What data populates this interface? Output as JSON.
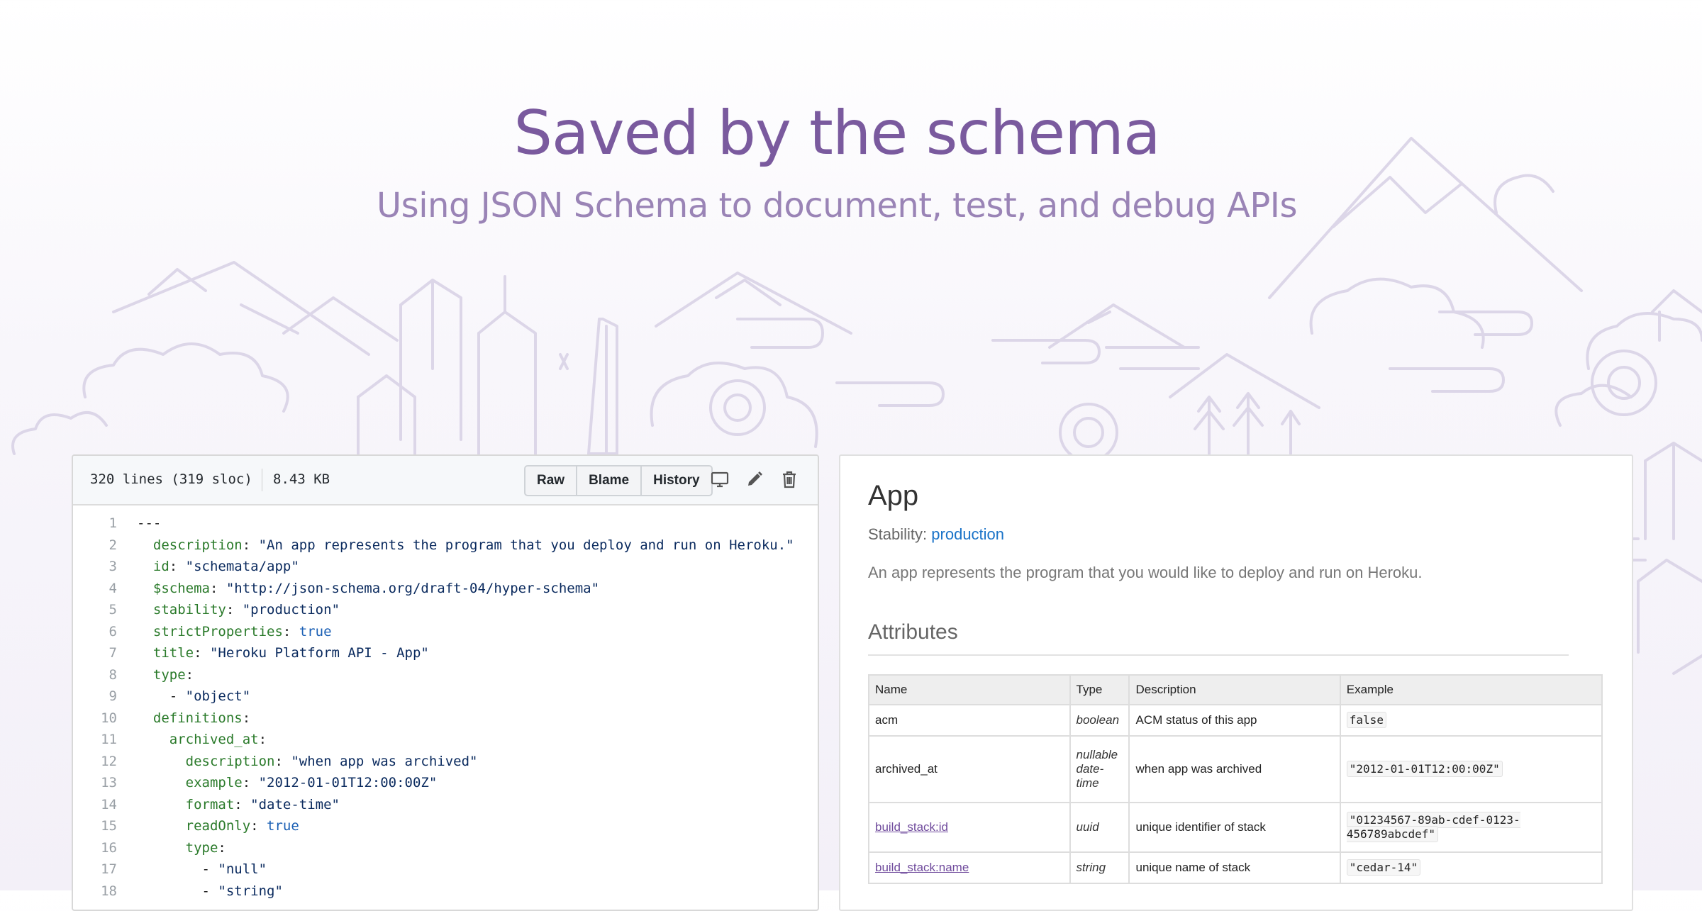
{
  "hero": {
    "title": "Saved by the schema",
    "subtitle": "Using JSON Schema to document, test, and debug APIs"
  },
  "code": {
    "lines_info": "320 lines (319 sloc)",
    "size": "8.43 KB",
    "buttons": [
      "Raw",
      "Blame",
      "History"
    ],
    "icons": [
      "desktop-icon",
      "pencil-icon",
      "trash-icon"
    ],
    "lines": [
      {
        "n": "1",
        "key": "---",
        "sep": "",
        "val": "",
        "vt": "p"
      },
      {
        "n": "2",
        "key": "  description",
        "sep": ": ",
        "val": "\"An app represents the program that you deploy and run on Heroku.\"",
        "vt": "s"
      },
      {
        "n": "3",
        "key": "  id",
        "sep": ": ",
        "val": "\"schemata/app\"",
        "vt": "s"
      },
      {
        "n": "4",
        "key": "  $schema",
        "sep": ": ",
        "val": "\"http://json-schema.org/draft-04/hyper-schema\"",
        "vt": "s"
      },
      {
        "n": "5",
        "key": "  stability",
        "sep": ": ",
        "val": "\"production\"",
        "vt": "s"
      },
      {
        "n": "6",
        "key": "  strictProperties",
        "sep": ": ",
        "val": "true",
        "vt": "b"
      },
      {
        "n": "7",
        "key": "  title",
        "sep": ": ",
        "val": "\"Heroku Platform API - App\"",
        "vt": "s"
      },
      {
        "n": "8",
        "key": "  type",
        "sep": ":",
        "val": "",
        "vt": "p"
      },
      {
        "n": "9",
        "key": "",
        "sep": "    - ",
        "val": "\"object\"",
        "vt": "s"
      },
      {
        "n": "10",
        "key": "  definitions",
        "sep": ":",
        "val": "",
        "vt": "p"
      },
      {
        "n": "11",
        "key": "    archived_at",
        "sep": ":",
        "val": "",
        "vt": "p"
      },
      {
        "n": "12",
        "key": "      description",
        "sep": ": ",
        "val": "\"when app was archived\"",
        "vt": "s"
      },
      {
        "n": "13",
        "key": "      example",
        "sep": ": ",
        "val": "\"2012-01-01T12:00:00Z\"",
        "vt": "s"
      },
      {
        "n": "14",
        "key": "      format",
        "sep": ": ",
        "val": "\"date-time\"",
        "vt": "s"
      },
      {
        "n": "15",
        "key": "      readOnly",
        "sep": ": ",
        "val": "true",
        "vt": "b"
      },
      {
        "n": "16",
        "key": "      type",
        "sep": ":",
        "val": "",
        "vt": "p"
      },
      {
        "n": "17",
        "key": "",
        "sep": "        - ",
        "val": "\"null\"",
        "vt": "s"
      },
      {
        "n": "18",
        "key": "",
        "sep": "        - ",
        "val": "\"string\"",
        "vt": "s"
      }
    ]
  },
  "doc": {
    "title": "App",
    "stability_label": "Stability:",
    "stability_value": "production",
    "description": "An app represents the program that you would like to deploy and run on Heroku.",
    "attributes_heading": "Attributes",
    "columns": [
      "Name",
      "Type",
      "Description",
      "Example"
    ],
    "rows": [
      {
        "name": "acm",
        "link": false,
        "type": "boolean",
        "description": "ACM status of this app",
        "example": "false"
      },
      {
        "name": "archived_at",
        "link": false,
        "type": "nullable date-time",
        "description": "when app was archived",
        "example": "\"2012-01-01T12:00:00Z\""
      },
      {
        "name": "build_stack:id",
        "link": true,
        "type": "uuid",
        "description": "unique identifier of stack",
        "example": "\"01234567-89ab-cdef-0123-456789abcdef\""
      },
      {
        "name": "build_stack:name",
        "link": true,
        "type": "string",
        "description": "unique name of stack",
        "example": "\"cedar-14\""
      }
    ]
  }
}
